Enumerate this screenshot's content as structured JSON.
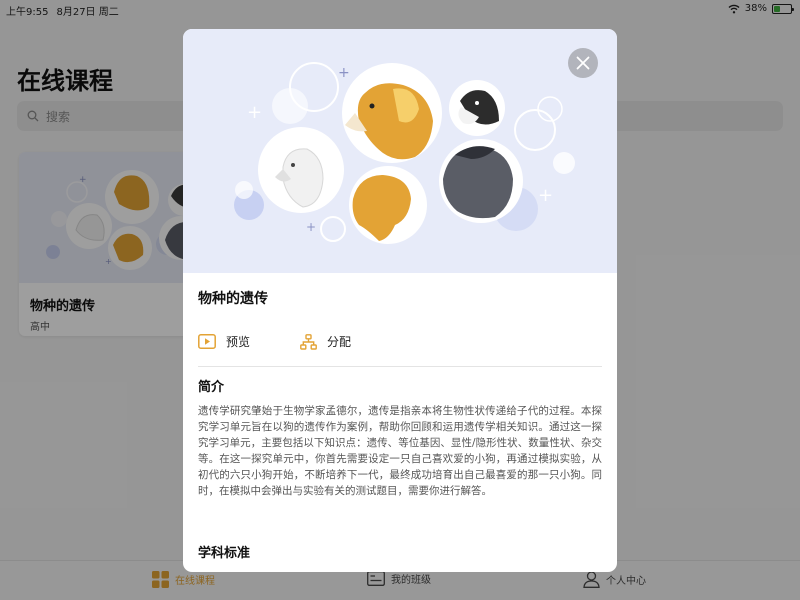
{
  "status_bar": {
    "time": "上午9:55",
    "date": "8月27日 周二",
    "battery": "38%",
    "battery_level": 0.38
  },
  "page": {
    "title": "在线课程",
    "search_placeholder": "搜索"
  },
  "course_card": {
    "title": "物种的遗传",
    "level": "高中"
  },
  "tab_bar": {
    "items": [
      {
        "label": "在线课程",
        "icon": "grid-icon",
        "active": true
      },
      {
        "label": "我的班级",
        "icon": "class-board-icon",
        "active": false
      },
      {
        "label": "个人中心",
        "icon": "person-icon",
        "active": false
      }
    ]
  },
  "modal": {
    "title": "物种的遗传",
    "actions": [
      {
        "label": "预览",
        "icon": "play-icon"
      },
      {
        "label": "分配",
        "icon": "hierarchy-icon"
      }
    ],
    "intro_heading": "简介",
    "intro_text": "遗传学研究肇始于生物学家孟德尔，遗传是指亲本将生物性状传递给子代的过程。本探究学习单元旨在以狗的遗传作为案例，帮助你回顾和运用遗传学相关知识。通过这一探究学习单元，主要包括以下知识点：遗传、等位基因、显性/隐形性状、数量性状、杂交等。在这一探究单元中，你首先需要设定一只自己喜欢爱的小狗，再通过模拟实验，从初代的六只小狗开始，不断培养下一代，最终成功培育出自己最喜爱的那一只小狗。同时，在模拟中会弹出与实验有关的测试题目，需要你进行解答。",
    "standards_heading": "学科标准"
  },
  "colors": {
    "accent": "#e3a335",
    "hero_bg": "#e7ebf9"
  }
}
